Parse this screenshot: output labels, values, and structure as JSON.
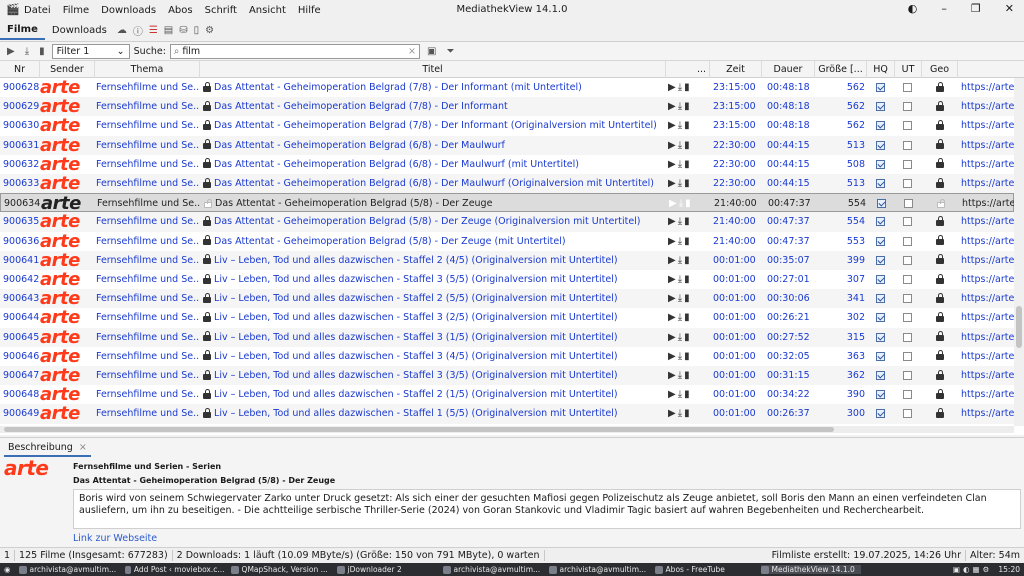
{
  "window": {
    "title": "MediathekView 14.1.0"
  },
  "menu": [
    "Datei",
    "Filme",
    "Downloads",
    "Abos",
    "Schrift",
    "Ansicht",
    "Hilfe"
  ],
  "tabs": {
    "filme": "Filme",
    "downloads": "Downloads"
  },
  "filter": {
    "selected": "Filter 1",
    "search_label": "Suche:",
    "search_value": "film"
  },
  "columns": [
    "Nr",
    "Sender",
    "Thema",
    "Titel",
    "...",
    "Zeit",
    "Dauer",
    "Größe [...",
    "HQ",
    "UT",
    "Geo"
  ],
  "rows": [
    {
      "nr": "900628",
      "sender": "arte",
      "thema": "Fernsehfilme und Se...",
      "titel": "Das Attentat - Geheimoperation Belgrad (7/8) - Der Informant (mit Untertitel)",
      "zeit": "23:15:00",
      "dauer": "00:48:18",
      "groesse": "562",
      "hq": true,
      "ut": false,
      "url": "https://arte"
    },
    {
      "nr": "900629",
      "sender": "arte",
      "thema": "Fernsehfilme und Se...",
      "titel": "Das Attentat - Geheimoperation Belgrad (7/8) - Der Informant",
      "zeit": "23:15:00",
      "dauer": "00:48:18",
      "groesse": "562",
      "hq": true,
      "ut": false,
      "url": "https://arte"
    },
    {
      "nr": "900630",
      "sender": "arte",
      "thema": "Fernsehfilme und Se...",
      "titel": "Das Attentat - Geheimoperation Belgrad (7/8) - Der Informant (Originalversion mit Untertitel)",
      "zeit": "23:15:00",
      "dauer": "00:48:18",
      "groesse": "562",
      "hq": true,
      "ut": false,
      "url": "https://arte"
    },
    {
      "nr": "900631",
      "sender": "arte",
      "thema": "Fernsehfilme und Se...",
      "titel": "Das Attentat - Geheimoperation Belgrad (6/8) - Der Maulwurf",
      "zeit": "22:30:00",
      "dauer": "00:44:15",
      "groesse": "513",
      "hq": true,
      "ut": false,
      "url": "https://arte"
    },
    {
      "nr": "900632",
      "sender": "arte",
      "thema": "Fernsehfilme und Se...",
      "titel": "Das Attentat - Geheimoperation Belgrad (6/8) - Der Maulwurf (mit Untertitel)",
      "zeit": "22:30:00",
      "dauer": "00:44:15",
      "groesse": "508",
      "hq": true,
      "ut": false,
      "url": "https://arte"
    },
    {
      "nr": "900633",
      "sender": "arte",
      "thema": "Fernsehfilme und Se...",
      "titel": "Das Attentat - Geheimoperation Belgrad (6/8) - Der Maulwurf (Originalversion mit Untertitel)",
      "zeit": "22:30:00",
      "dauer": "00:44:15",
      "groesse": "513",
      "hq": true,
      "ut": false,
      "url": "https://arte"
    },
    {
      "nr": "900634",
      "sender": "arte",
      "thema": "Fernsehfilme und Se...",
      "titel": "Das Attentat - Geheimoperation Belgrad (5/8) - Der Zeuge",
      "zeit": "21:40:00",
      "dauer": "00:47:37",
      "groesse": "554",
      "hq": true,
      "ut": false,
      "url": "https://arte",
      "selected": true
    },
    {
      "nr": "900635",
      "sender": "arte",
      "thema": "Fernsehfilme und Se...",
      "titel": "Das Attentat - Geheimoperation Belgrad (5/8) - Der Zeuge (Originalversion mit Untertitel)",
      "zeit": "21:40:00",
      "dauer": "00:47:37",
      "groesse": "554",
      "hq": true,
      "ut": false,
      "url": "https://arte"
    },
    {
      "nr": "900636",
      "sender": "arte",
      "thema": "Fernsehfilme und Se...",
      "titel": "Das Attentat - Geheimoperation Belgrad (5/8) - Der Zeuge (mit Untertitel)",
      "zeit": "21:40:00",
      "dauer": "00:47:37",
      "groesse": "553",
      "hq": true,
      "ut": false,
      "url": "https://arte"
    },
    {
      "nr": "900641",
      "sender": "arte",
      "thema": "Fernsehfilme und Se...",
      "titel": "Liv – Leben, Tod und alles dazwischen - Staffel 2 (4/5) (Originalversion mit Untertitel)",
      "zeit": "00:01:00",
      "dauer": "00:35:07",
      "groesse": "399",
      "hq": true,
      "ut": false,
      "url": "https://arte"
    },
    {
      "nr": "900642",
      "sender": "arte",
      "thema": "Fernsehfilme und Se...",
      "titel": "Liv – Leben, Tod und alles dazwischen - Staffel 3 (5/5) (Originalversion mit Untertitel)",
      "zeit": "00:01:00",
      "dauer": "00:27:01",
      "groesse": "307",
      "hq": true,
      "ut": false,
      "url": "https://arte"
    },
    {
      "nr": "900643",
      "sender": "arte",
      "thema": "Fernsehfilme und Se...",
      "titel": "Liv – Leben, Tod und alles dazwischen - Staffel 2 (5/5) (Originalversion mit Untertitel)",
      "zeit": "00:01:00",
      "dauer": "00:30:06",
      "groesse": "341",
      "hq": true,
      "ut": false,
      "url": "https://arte"
    },
    {
      "nr": "900644",
      "sender": "arte",
      "thema": "Fernsehfilme und Se...",
      "titel": "Liv – Leben, Tod und alles dazwischen - Staffel 3 (2/5) (Originalversion mit Untertitel)",
      "zeit": "00:01:00",
      "dauer": "00:26:21",
      "groesse": "302",
      "hq": true,
      "ut": false,
      "url": "https://arte"
    },
    {
      "nr": "900645",
      "sender": "arte",
      "thema": "Fernsehfilme und Se...",
      "titel": "Liv – Leben, Tod und alles dazwischen - Staffel 3 (1/5) (Originalversion mit Untertitel)",
      "zeit": "00:01:00",
      "dauer": "00:27:52",
      "groesse": "315",
      "hq": true,
      "ut": false,
      "url": "https://arte"
    },
    {
      "nr": "900646",
      "sender": "arte",
      "thema": "Fernsehfilme und Se...",
      "titel": "Liv – Leben, Tod und alles dazwischen - Staffel 3 (4/5) (Originalversion mit Untertitel)",
      "zeit": "00:01:00",
      "dauer": "00:32:05",
      "groesse": "363",
      "hq": true,
      "ut": false,
      "url": "https://arte"
    },
    {
      "nr": "900647",
      "sender": "arte",
      "thema": "Fernsehfilme und Se...",
      "titel": "Liv – Leben, Tod und alles dazwischen - Staffel 3 (3/5) (Originalversion mit Untertitel)",
      "zeit": "00:01:00",
      "dauer": "00:31:15",
      "groesse": "362",
      "hq": true,
      "ut": false,
      "url": "https://arte"
    },
    {
      "nr": "900648",
      "sender": "arte",
      "thema": "Fernsehfilme und Se...",
      "titel": "Liv – Leben, Tod und alles dazwischen - Staffel 2 (1/5) (Originalversion mit Untertitel)",
      "zeit": "00:01:00",
      "dauer": "00:34:22",
      "groesse": "390",
      "hq": true,
      "ut": false,
      "url": "https://arte"
    },
    {
      "nr": "900649",
      "sender": "arte",
      "thema": "Fernsehfilme und Se...",
      "titel": "Liv – Leben, Tod und alles dazwischen - Staffel 1 (5/5) (Originalversion mit Untertitel)",
      "zeit": "00:01:00",
      "dauer": "00:26:37",
      "groesse": "300",
      "hq": true,
      "ut": false,
      "url": "https://arte"
    }
  ],
  "description": {
    "tab": "Beschreibung",
    "sender_logo": "arte",
    "thema": "Fernsehfilme und Serien - Serien",
    "titel": "Das Attentat - Geheimoperation Belgrad (5/8) - Der Zeuge",
    "text": "Boris wird von seinem Schwiegervater Zarko unter Druck gesetzt: Als sich einer der gesuchten Mafiosi gegen Polizeischutz als Zeuge anbietet, soll Boris den Mann an einen verfeindeten Clan ausliefern, um ihn zu beseitigen. - Die achtteilige serbische Thriller-Serie (2024) von Goran Stankovic und Vladimir Tagic basiert auf wahren Begebenheiten und Recherchearbeit.",
    "link": "Link zur Webseite"
  },
  "status": {
    "selected": "1",
    "films": "125 Filme (Insgesamt: 677283)",
    "downloads": "2 Downloads: 1 läuft (10.09 MByte/s) (Größe: 150 von 791 MByte), 0 warten",
    "list_created": "Filmliste erstellt: 19.07.2025, 14:26 Uhr",
    "age": "Alter: 54m"
  },
  "taskbar": {
    "items": [
      "archivista@avmultim...",
      "Add Post ‹ moviebox.c...",
      "QMapShack, Version ...",
      "jDownloader 2",
      "archivista@avmultim...",
      "archivista@avmultim...",
      "Abos - FreeTube",
      "MediathekView 14.1.0"
    ],
    "clock": "15:20"
  },
  "colors": {
    "link": "#1a3ad0",
    "arte": "#ff3a1a",
    "accent": "#3a6fb5"
  }
}
